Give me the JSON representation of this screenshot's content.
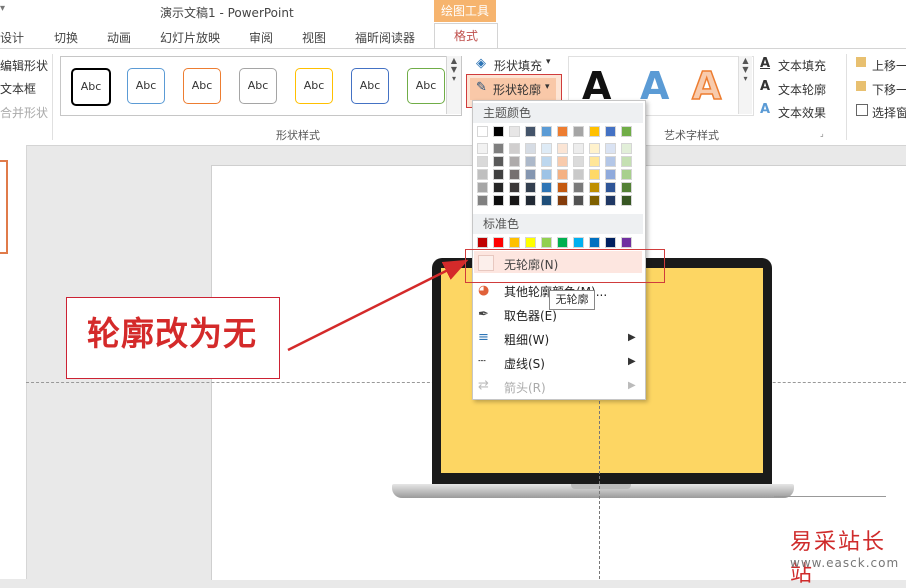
{
  "window": {
    "title": "演示文稿1 - PowerPoint"
  },
  "contextual_group": "绘图工具",
  "tabs": [
    "设计",
    "切换",
    "动画",
    "幻灯片放映",
    "审阅",
    "视图",
    "福昕阅读器"
  ],
  "active_tab": "格式",
  "ribbon": {
    "left_fragments": [
      "编辑形状",
      "文本框",
      "合并形状"
    ],
    "style_gallery": [
      "Abc",
      "Abc",
      "Abc",
      "Abc",
      "Abc",
      "Abc",
      "Abc"
    ],
    "shape_fill": "形状填充",
    "shape_outline": "形状轮廓",
    "group_shape_styles": "形状样式",
    "group_wordart": "艺术字样式",
    "wordart_samples": [
      "A",
      "A",
      "A"
    ],
    "text_fill": "文本填充",
    "text_outline": "文本轮廓",
    "text_effects": "文本效果",
    "bring_forward": "上移一",
    "send_backward": "下移一",
    "selection_pane": "选择窗"
  },
  "menu": {
    "theme_colors_header": "主题颜色",
    "standard_colors_header": "标准色",
    "no_outline": "无轮廓(N)",
    "more_colors": "其他轮廓颜色(M)...",
    "eyedropper": "取色器(E)",
    "weight": "粗细(W)",
    "dashes": "虚线(S)",
    "arrows": "箭头(R)",
    "tooltip": "无轮廓"
  },
  "theme_colors_top": [
    "#ffffff",
    "#000000",
    "#e7e6e6",
    "#44546a",
    "#5b9bd5",
    "#ed7d31",
    "#a5a5a5",
    "#ffc000",
    "#4472c4",
    "#70ad47"
  ],
  "theme_colors_shades": [
    [
      "#f2f2f2",
      "#d9d9d9",
      "#bfbfbf",
      "#a6a6a6",
      "#808080"
    ],
    [
      "#7f7f7f",
      "#595959",
      "#404040",
      "#262626",
      "#0d0d0d"
    ],
    [
      "#d0cece",
      "#aeabab",
      "#757070",
      "#3b3838",
      "#171616"
    ],
    [
      "#d6dce4",
      "#adb9ca",
      "#8496b0",
      "#333f4f",
      "#222a35"
    ],
    [
      "#deebf6",
      "#bdd7ee",
      "#9dc3e6",
      "#2e75b6",
      "#1f4e79"
    ],
    [
      "#fbe5d5",
      "#f8cbad",
      "#f4b183",
      "#c55a11",
      "#843c0b"
    ],
    [
      "#ededed",
      "#dbdbdb",
      "#c9c9c9",
      "#7b7b7b",
      "#525252"
    ],
    [
      "#fff2cc",
      "#ffe699",
      "#ffd966",
      "#bf8f00",
      "#7f6000"
    ],
    [
      "#dae3f3",
      "#b4c7e7",
      "#8faadc",
      "#2f5597",
      "#203864"
    ],
    [
      "#e2efd9",
      "#c5e0b3",
      "#a8d08d",
      "#538135",
      "#375623"
    ]
  ],
  "standard_colors": [
    "#c00000",
    "#ff0000",
    "#ffc000",
    "#ffff00",
    "#92d050",
    "#00b050",
    "#00b0f0",
    "#0070c0",
    "#002060",
    "#7030a0"
  ],
  "gallery_border_colors": [
    "#000000",
    "#5b9bd5",
    "#ed7d31",
    "#a5a5a5",
    "#ffc000",
    "#4472c4",
    "#70ad47"
  ],
  "annotation": {
    "text": "轮廓改为无"
  },
  "watermark": {
    "line1": "易采站长站",
    "line2": "www.easck.com"
  }
}
